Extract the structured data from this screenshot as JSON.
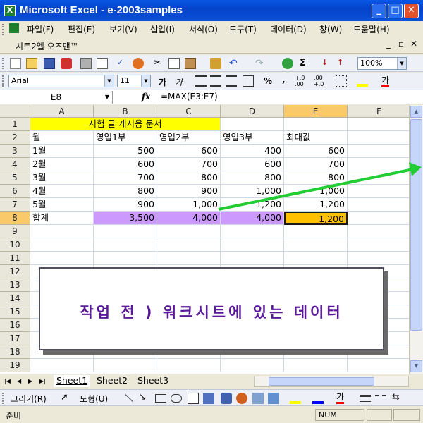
{
  "window": {
    "app_icon": "X",
    "title": "Microsoft Excel - e-2003samples",
    "minimize": "_",
    "maximize": "□",
    "close": "✕"
  },
  "menu": [
    "파일(F)",
    "편집(E)",
    "보기(V)",
    "삽입(I)",
    "서식(O)",
    "도구(T)",
    "데이터(D)",
    "창(W)",
    "도움말(H)"
  ],
  "doc_window": {
    "title": "시트2엘 오즈맨™",
    "controls": [
      "_",
      "▫",
      "✕"
    ]
  },
  "toolbar_standard": {
    "icons": [
      "new-icon",
      "open-icon",
      "save-icon",
      "permission-icon",
      "print-icon",
      "print-preview-icon",
      "spelling-icon",
      "research-icon",
      "cut-icon",
      "copy-icon",
      "paste-icon",
      "format-painter-icon",
      "undo-icon",
      "redo-icon",
      "hyperlink-icon",
      "autosum-icon",
      "sort-ascending-icon",
      "sort-descending-icon"
    ],
    "zoom": "100%"
  },
  "toolbar_format": {
    "font": "Arial",
    "size": "11",
    "bold": "가",
    "italic": "가",
    "percent": "%",
    "comma": ",",
    "inc_decimal": "+.0\n.00",
    "dec_decimal": ".00\n+.0",
    "fill_label": "가"
  },
  "formula_bar": {
    "name_box": "E8",
    "fx": "fx",
    "formula": "=MAX(E3:E7)"
  },
  "columns": [
    "A",
    "B",
    "C",
    "D",
    "E",
    "F"
  ],
  "selected_column": "E",
  "selected_row": "8",
  "rows": [
    "1",
    "2",
    "3",
    "4",
    "5",
    "6",
    "7",
    "8",
    "9",
    "10",
    "11",
    "12",
    "13",
    "14",
    "15",
    "16",
    "17",
    "18",
    "19"
  ],
  "sheet": {
    "title_cell": "시험 글 게시용 문서",
    "headers": [
      "월",
      "영업1부",
      "영업2부",
      "영업3부",
      "최대값"
    ],
    "data": [
      [
        "1월",
        "500",
        "600",
        "400",
        "600"
      ],
      [
        "2월",
        "600",
        "700",
        "600",
        "700"
      ],
      [
        "3월",
        "700",
        "800",
        "800",
        "800"
      ],
      [
        "4월",
        "800",
        "900",
        "1,000",
        "1,000"
      ],
      [
        "5월",
        "900",
        "1,000",
        "1,200",
        "1,200"
      ]
    ],
    "total": [
      "합계",
      "3,500",
      "4,000",
      "4,000",
      "1,200"
    ]
  },
  "sheet_tabs": [
    "Sheet1",
    "Sheet2",
    "Sheet3"
  ],
  "drawing_toolbar": {
    "draw_label": "그리기(R)",
    "autoshapes_label": "도형(U)",
    "font_color_label": "가"
  },
  "status": {
    "ready": "준비",
    "num": "NUM"
  },
  "callout_text": "작업 전 ) 워크시트에 있는 데이터",
  "colors": {
    "title_fill": "#ffff00",
    "total_fill": "#cc99ff",
    "selected_fill": "#ffc000",
    "arrow": "#22cc33",
    "callout_text": "#5a1a9a"
  }
}
